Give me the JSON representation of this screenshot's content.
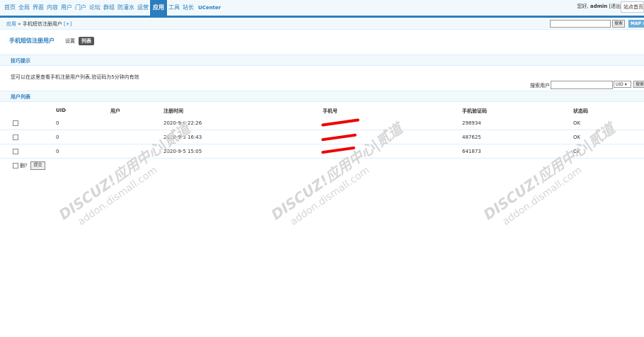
{
  "nav": {
    "items": [
      "首页",
      "全局",
      "界面",
      "内容",
      "用户",
      "门户",
      "论坛",
      "群组",
      "防灌水",
      "运营",
      "应用",
      "工具",
      "站长",
      "UCenter"
    ],
    "active": "应用"
  },
  "user": {
    "greeting": "您好,",
    "name": "admin",
    "logout": "[退出]",
    "home": "站点首页"
  },
  "breadcrumb": {
    "root": "应用",
    "sep": " » ",
    "page": "手机短信注册用户",
    "add": " [+]"
  },
  "top_search": {
    "button": "搜索",
    "map": "MAP ⊕"
  },
  "page": {
    "title": "手机短信注册用户",
    "tab_settings": "设置",
    "tab_list": "列表"
  },
  "tips": {
    "title": "技巧提示",
    "text": "您可以在这里查看手机注册用户列表,验证码为5分钟内有效"
  },
  "search": {
    "label": "搜索用户",
    "select": "UID ▾",
    "button": "搜索"
  },
  "table": {
    "title": "用户列表",
    "headers": [
      "UID",
      "用户",
      "注册时间",
      "手机号",
      "手机验证码",
      "状态码"
    ],
    "rows": [
      {
        "uid": "0",
        "user": "",
        "time": "2020-9-6 22:26",
        "phone": "",
        "code": "298934",
        "status": "OK"
      },
      {
        "uid": "0",
        "user": "",
        "time": "2020-9-5 16:43",
        "phone": "",
        "code": "487625",
        "status": "OK"
      },
      {
        "uid": "0",
        "user": "",
        "time": "2020-9-5 15:05",
        "code": "641873",
        "phone": "",
        "status": "OK"
      }
    ]
  },
  "footer": {
    "delete": "删?",
    "submit": "提交"
  },
  "watermark": {
    "line1": "DISCUZ!应用中心|贰道",
    "line2": "addon.dismall.com"
  }
}
